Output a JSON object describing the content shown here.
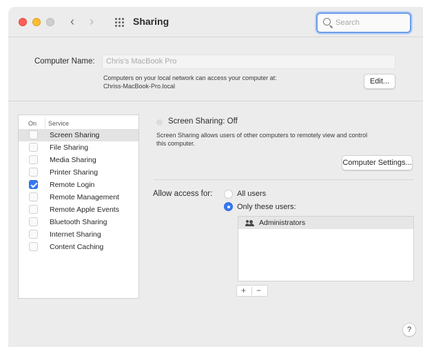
{
  "window": {
    "title": "Sharing",
    "search": {
      "placeholder": "Search"
    }
  },
  "computer_name": {
    "label": "Computer Name:",
    "value": "Chris's MacBook Pro",
    "info_line1": "Computers on your local network can access your computer at:",
    "info_line2": "Chriss-MacBook-Pro.local",
    "edit_button": "Edit..."
  },
  "services": {
    "header_on": "On",
    "header_service": "Service",
    "items": [
      {
        "label": "Screen Sharing",
        "checked": false,
        "selected": true
      },
      {
        "label": "File Sharing",
        "checked": false,
        "selected": false
      },
      {
        "label": "Media Sharing",
        "checked": false,
        "selected": false
      },
      {
        "label": "Printer Sharing",
        "checked": false,
        "selected": false
      },
      {
        "label": "Remote Login",
        "checked": true,
        "selected": false
      },
      {
        "label": "Remote Management",
        "checked": false,
        "selected": false
      },
      {
        "label": "Remote Apple Events",
        "checked": false,
        "selected": false
      },
      {
        "label": "Bluetooth Sharing",
        "checked": false,
        "selected": false
      },
      {
        "label": "Internet Sharing",
        "checked": false,
        "selected": false
      },
      {
        "label": "Content Caching",
        "checked": false,
        "selected": false
      }
    ]
  },
  "detail": {
    "status": "Screen Sharing: Off",
    "desc_line1": "Screen Sharing allows users of other computers to remotely view and control",
    "desc_line2": "this computer.",
    "settings_button": "Computer Settings...",
    "allow_label": "Allow access for:",
    "option_all": "All users",
    "option_only": "Only these users:",
    "selected_option": "only",
    "users": [
      "Administrators"
    ],
    "add_label": "+",
    "remove_label": "−"
  },
  "help_label": "?",
  "colors": {
    "accent": "#3478f6",
    "close": "#ff5f57",
    "minimize": "#febc2e",
    "zoom_inactive": "#cfcfcf"
  }
}
